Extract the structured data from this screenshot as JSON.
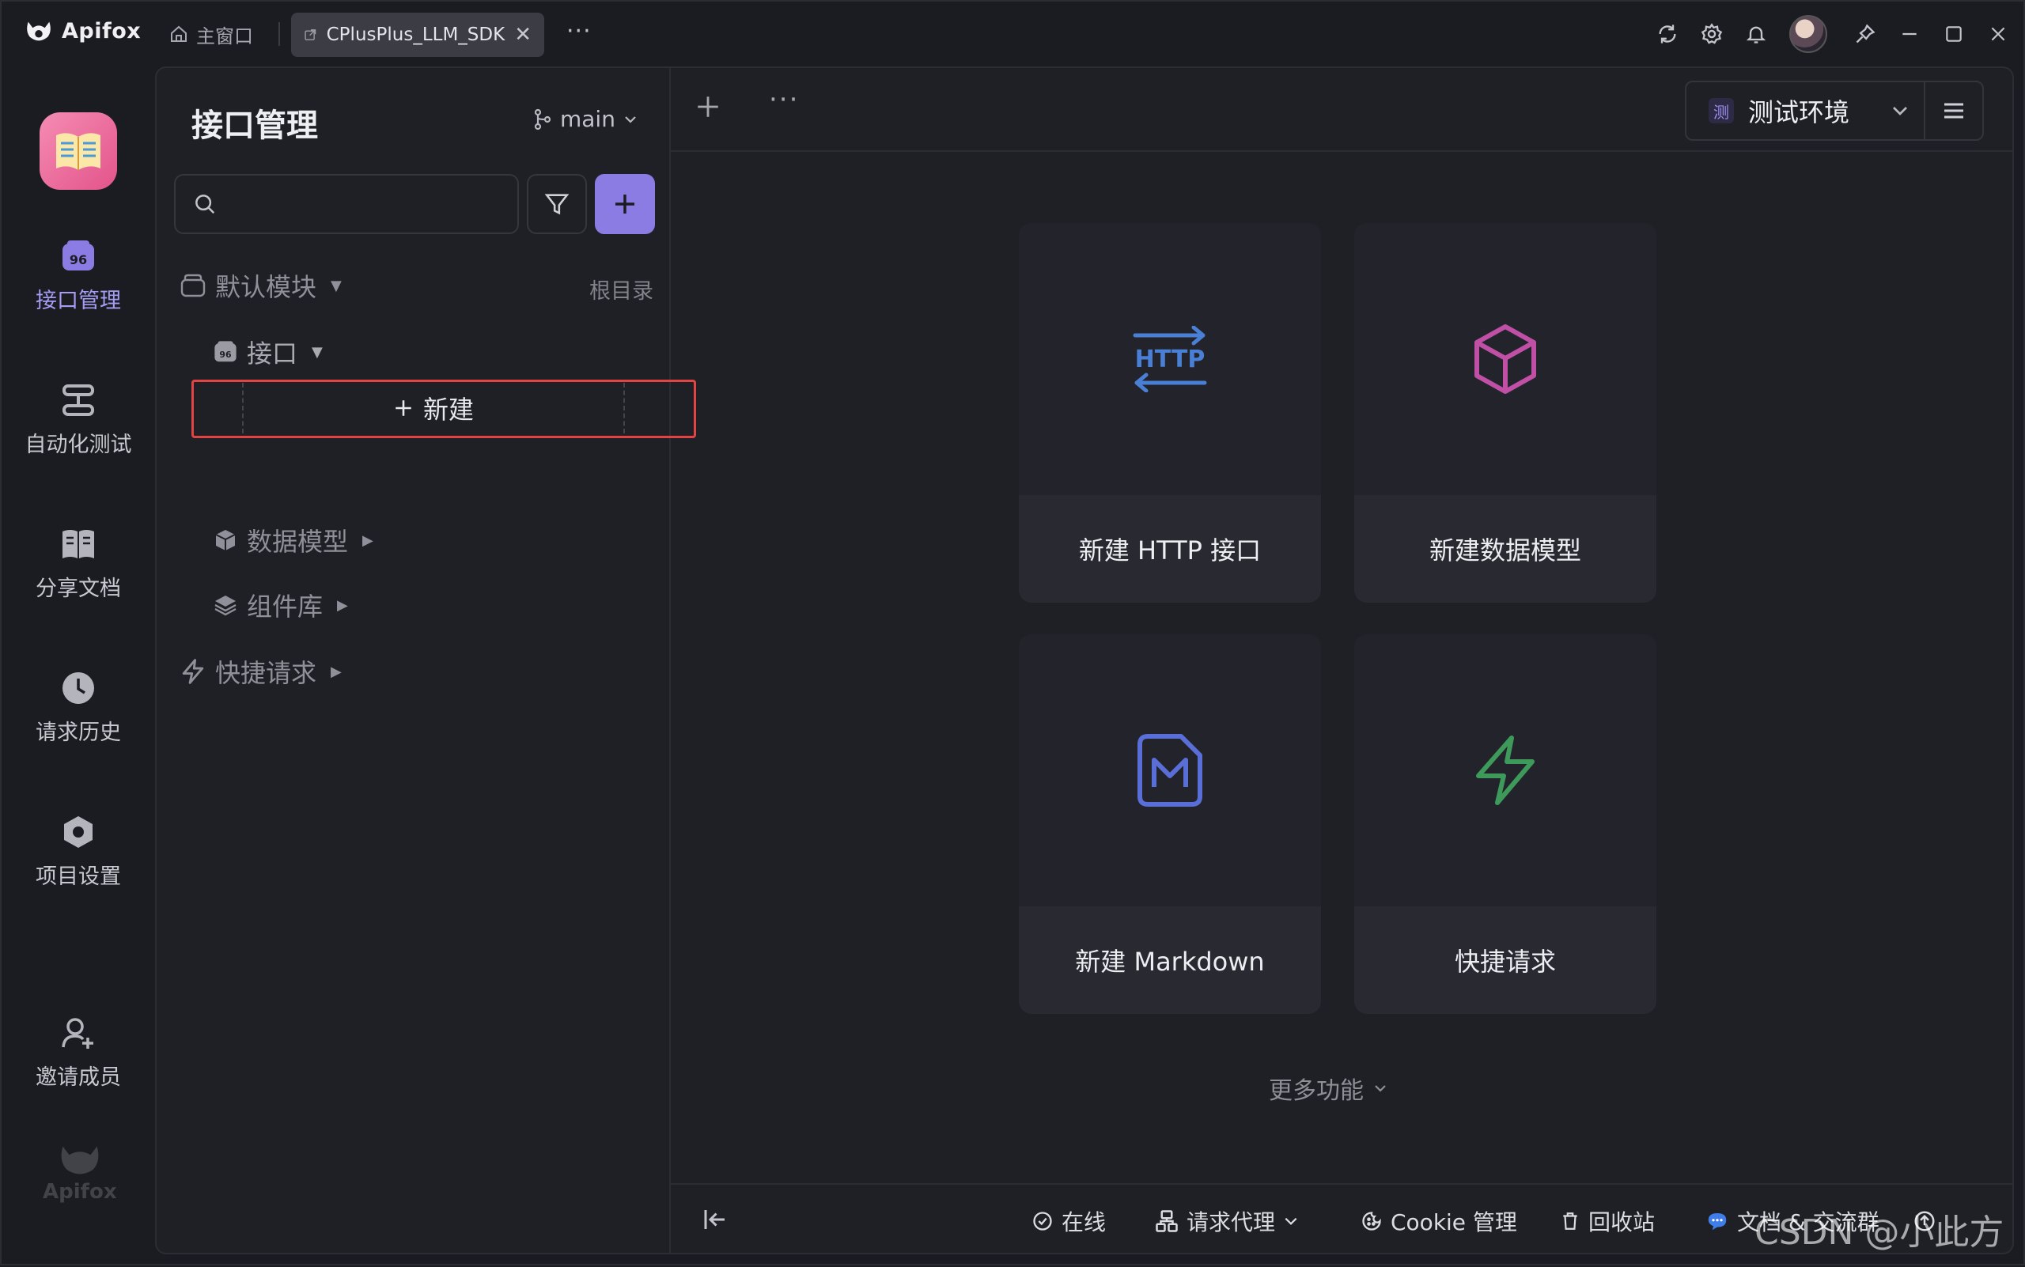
{
  "app": {
    "name": "Apifox"
  },
  "titlebar": {
    "home_tab": "主窗口",
    "project_tab": "CPlusPlus_LLM_SDK",
    "more": "···"
  },
  "rail": {
    "items": [
      {
        "label": "接口管理",
        "icon": "api-icon",
        "active": true
      },
      {
        "label": "自动化测试",
        "icon": "automation-icon",
        "active": false
      },
      {
        "label": "分享文档",
        "icon": "book-icon",
        "active": false
      },
      {
        "label": "请求历史",
        "icon": "clock-icon",
        "active": false
      },
      {
        "label": "项目设置",
        "icon": "settings-hex-icon",
        "active": false
      }
    ],
    "invite": "邀请成员",
    "footer_brand": "Apifox"
  },
  "sidebar": {
    "title": "接口管理",
    "branch": "main",
    "search": {
      "value": "",
      "placeholder": ""
    },
    "tree": {
      "module": "默认模块",
      "interfaces": "接口",
      "root_dir": "根目录",
      "new_label": "新建",
      "data_model": "数据模型",
      "components": "组件库",
      "quick_request": "快捷请求"
    }
  },
  "main": {
    "environment": {
      "badge": "测",
      "label": "测试环境"
    },
    "cards": [
      {
        "label": "新建 HTTP 接口",
        "icon": "http-icon",
        "color": "#4a7fd6"
      },
      {
        "label": "新建数据模型",
        "icon": "cube-icon",
        "color": "#c04fa6"
      },
      {
        "label": "新建 Markdown",
        "icon": "markdown-icon",
        "color": "#5a6ed8"
      },
      {
        "label": "快捷请求",
        "icon": "lightning-icon",
        "color": "#3e9a5a"
      }
    ],
    "more_features": "更多功能"
  },
  "statusbar": {
    "online": "在线",
    "proxy": "请求代理",
    "cookie": "Cookie 管理",
    "recycle": "回收站",
    "docs": "文档 & 交流群"
  },
  "watermark": "CSDN @小此方",
  "colors": {
    "accent": "#8a7ce2",
    "highlight_border": "#e24444",
    "background": "#1b1c22"
  }
}
